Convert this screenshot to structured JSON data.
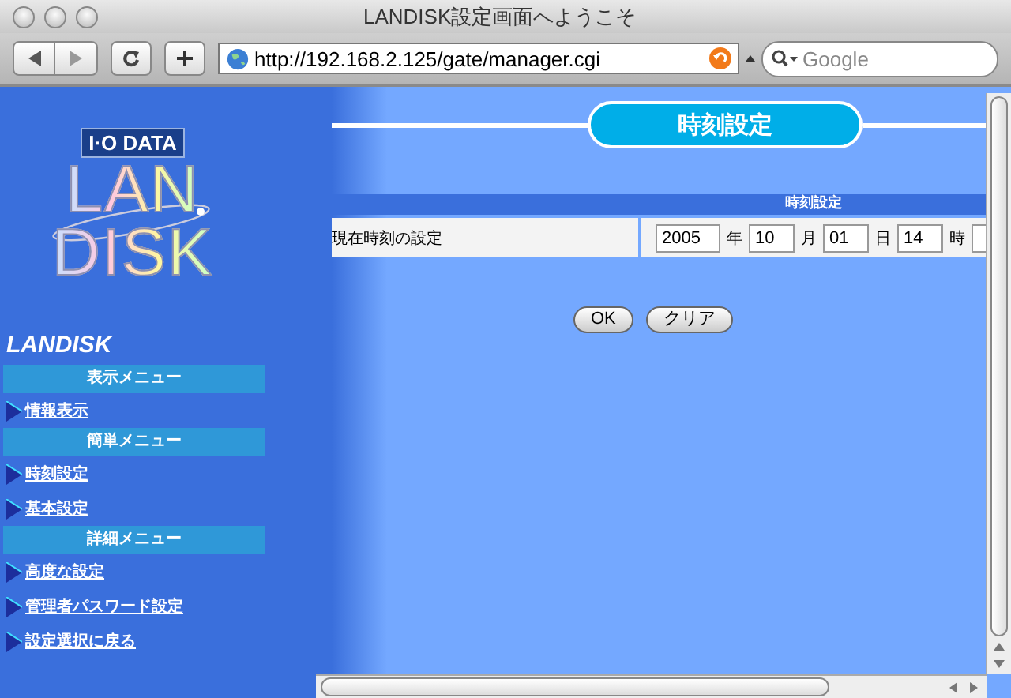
{
  "window": {
    "title": "LANDISK設定画面へようこそ"
  },
  "toolbar": {
    "url": "http://192.168.2.125/gate/manager.cgi",
    "search": {
      "placeholder": "Google"
    }
  },
  "sidebar": {
    "logo": {
      "brand": "I·O DATA",
      "product": [
        "LAN",
        "DISK"
      ]
    },
    "heading": "LANDISK",
    "sections": [
      {
        "title": "表示メニュー",
        "items": [
          {
            "label": "情報表示"
          }
        ]
      },
      {
        "title": "簡単メニュー",
        "items": [
          {
            "label": "時刻設定"
          },
          {
            "label": "基本設定"
          }
        ]
      },
      {
        "title": "詳細メニュー",
        "items": [
          {
            "label": "高度な設定"
          },
          {
            "label": "管理者パスワード設定"
          },
          {
            "label": "設定選択に戻る"
          }
        ]
      }
    ]
  },
  "main": {
    "page_title": "時刻設定",
    "table": {
      "header": "時刻設定",
      "row_label": "現在時刻の設定",
      "fields": [
        {
          "value": "2005",
          "unit": "年"
        },
        {
          "value": "10",
          "unit": "月"
        },
        {
          "value": "01",
          "unit": "日"
        },
        {
          "value": "14",
          "unit": "時"
        }
      ]
    },
    "buttons": [
      "OK",
      "クリア"
    ]
  }
}
